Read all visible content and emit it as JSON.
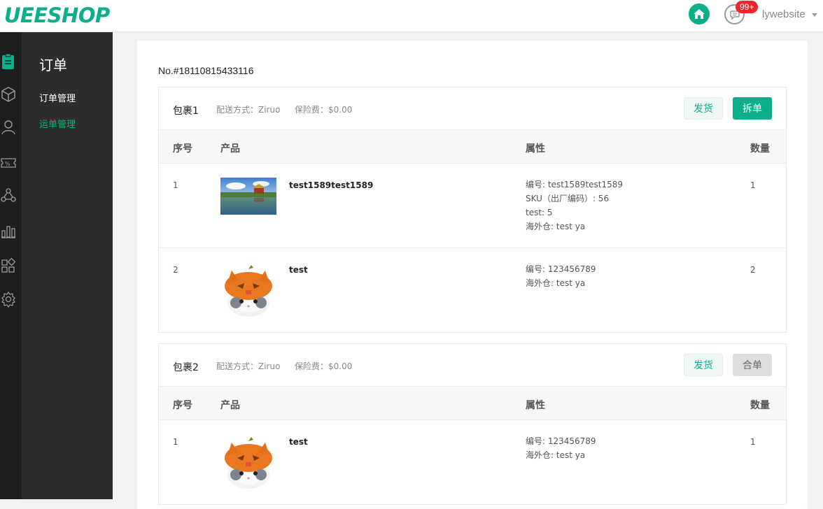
{
  "header": {
    "logo": "UEESHOP",
    "badge": "99+",
    "username": "lywebsite"
  },
  "sidebar": {
    "icons": [
      "order-icon",
      "product-box-icon",
      "user-icon",
      "coupon-icon",
      "network-icon",
      "stats-bar-icon",
      "apps-grid-icon",
      "settings-gear-icon"
    ]
  },
  "subnav": {
    "title": "订单",
    "items": [
      {
        "label": "订单管理"
      },
      {
        "label": "运单管理"
      }
    ]
  },
  "order": {
    "number": "No.#18110815433116"
  },
  "columns": {
    "index": "序号",
    "product": "产品",
    "attributes": "属性",
    "quantity": "数量"
  },
  "packages": [
    {
      "name": "包裹1",
      "shipping": "配送方式：Ziruo",
      "insurance": "保险费：$0.00",
      "ship_label": "发货",
      "action_label": "拆单",
      "rows": [
        {
          "index": "1",
          "product": "test1589test1589",
          "image": "landscape-palace-image",
          "attrs": [
            "编号: test1589test1589",
            "SKU（出厂编码）: 56",
            "test: 5",
            "海外仓: test ya"
          ],
          "qty": "1"
        },
        {
          "index": "2",
          "product": "test",
          "image": "pumpkin-cat-image",
          "attrs": [
            "编号: 123456789",
            "海外仓: test ya"
          ],
          "qty": "2"
        }
      ]
    },
    {
      "name": "包裹2",
      "shipping": "配送方式：Ziruo",
      "insurance": "保险费：$0.00",
      "ship_label": "发货",
      "action_label": "合单",
      "rows": [
        {
          "index": "1",
          "product": "test",
          "image": "pumpkin-cat-image",
          "attrs": [
            "编号: 123456789",
            "海外仓: test ya"
          ],
          "qty": "1"
        }
      ]
    }
  ],
  "colors": {
    "accent": "#0bb08a",
    "sidebar_dark": "#1d1e20",
    "subnav_bg": "#2c2d2f",
    "badge": "#f0262b"
  }
}
